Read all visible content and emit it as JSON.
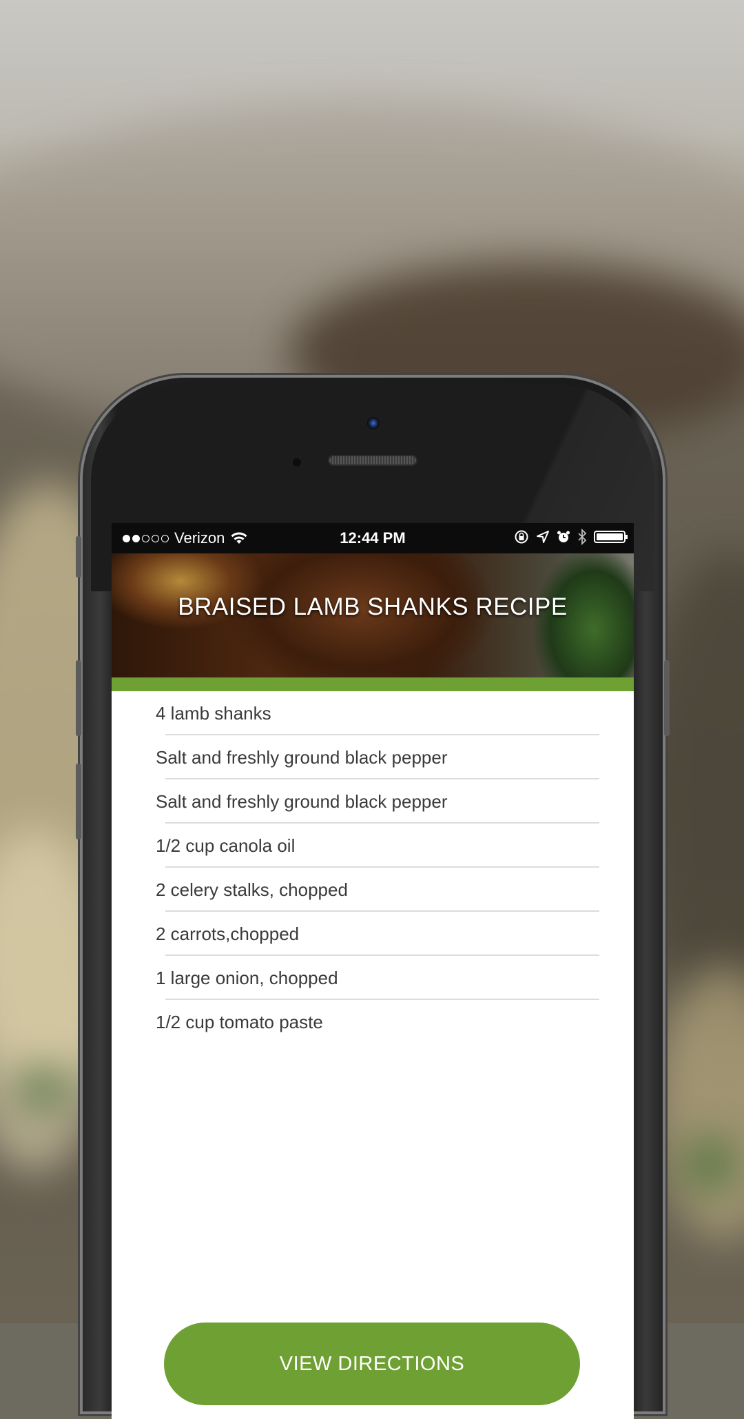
{
  "status_bar": {
    "carrier": "Verizon",
    "signal_dots_filled": 2,
    "signal_dots_total": 5,
    "time": "12:44 PM",
    "icons": [
      "wifi-icon",
      "orientation-lock-icon",
      "location-arrow-icon",
      "alarm-icon",
      "bluetooth-icon",
      "battery-icon"
    ],
    "battery_level": 1.0
  },
  "header": {
    "title": "BRAISED LAMB SHANKS RECIPE"
  },
  "ingredients": [
    "4 lamb shanks",
    "Salt and freshly ground black pepper",
    "Salt and freshly ground black pepper",
    "1/2 cup canola oil",
    "2 celery stalks, chopped",
    "2 carrots,chopped",
    "1 large onion, chopped",
    "1/2 cup tomato paste"
  ],
  "actions": {
    "view_directions_label": "VIEW DIRECTIONS"
  },
  "colors": {
    "accent_green": "#6fa033",
    "status_bar_bg": "#0c0c0c",
    "text_primary": "#3a3a3a",
    "divider": "#dcdcdc"
  }
}
